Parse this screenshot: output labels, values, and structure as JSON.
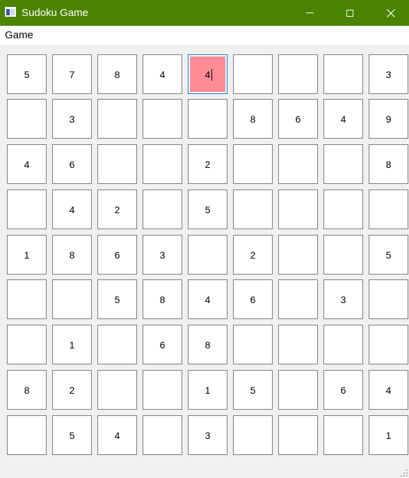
{
  "window": {
    "title": "Sudoku Game",
    "icon": "app-window-icon",
    "titlebar_color": "#4a8400",
    "controls": [
      "minimize-icon",
      "maximize-icon",
      "close-icon"
    ]
  },
  "menu": {
    "items": [
      {
        "label": "Game"
      }
    ]
  },
  "board": {
    "selected_cell": {
      "row": 0,
      "col": 4
    },
    "selected_color": "#ff8c95",
    "cells": [
      [
        "5",
        "7",
        "8",
        "4",
        "4",
        "",
        "",
        "",
        "3"
      ],
      [
        "",
        "3",
        "",
        "",
        "",
        "8",
        "6",
        "4",
        "9"
      ],
      [
        "4",
        "6",
        "",
        "",
        "2",
        "",
        "",
        "",
        "8"
      ],
      [
        "",
        "4",
        "2",
        "",
        "5",
        "",
        "",
        "",
        ""
      ],
      [
        "1",
        "8",
        "6",
        "3",
        "",
        "2",
        "",
        "",
        "5"
      ],
      [
        "",
        "",
        "5",
        "8",
        "4",
        "6",
        "",
        "3",
        ""
      ],
      [
        "",
        "1",
        "",
        "6",
        "8",
        "",
        "",
        "",
        ""
      ],
      [
        "8",
        "2",
        "",
        "",
        "1",
        "5",
        "",
        "6",
        "4"
      ],
      [
        "",
        "5",
        "4",
        "",
        "3",
        "",
        "",
        "",
        "1"
      ]
    ]
  }
}
